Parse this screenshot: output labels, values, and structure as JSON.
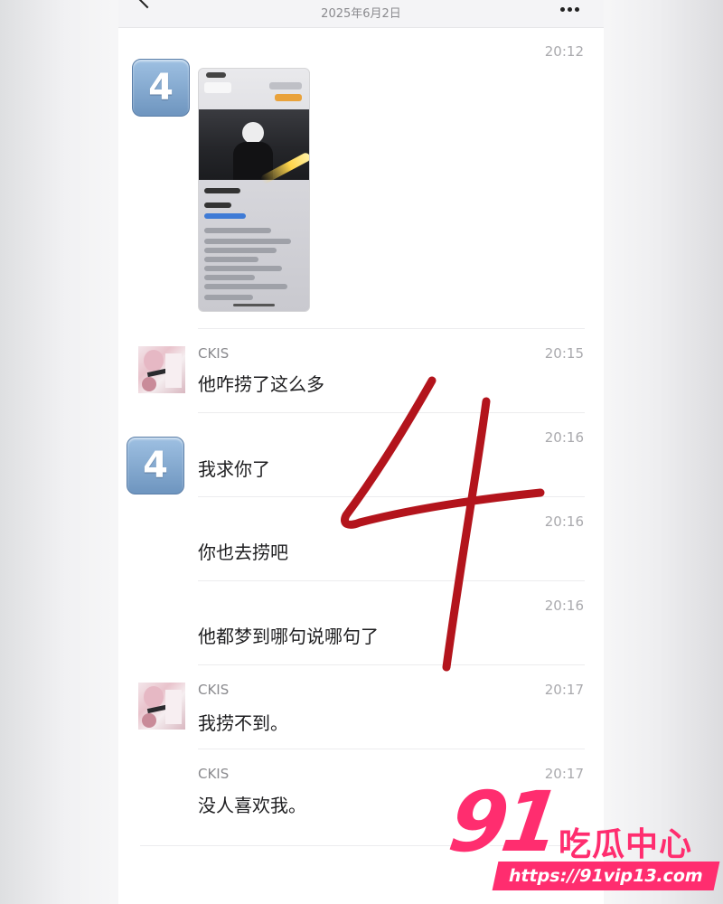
{
  "header": {
    "title": "",
    "date": "2025年6月2日"
  },
  "messages": [
    {
      "id": "m1",
      "sender": "",
      "avatar": "keycap-4-emoji",
      "time": "20:12",
      "type": "image"
    },
    {
      "id": "m2",
      "sender": "CKIS",
      "avatar": "photo",
      "time": "20:15",
      "text": "他咋捞了这么多"
    },
    {
      "id": "m3",
      "sender": "",
      "avatar": "keycap-4-emoji",
      "time": "20:16",
      "text": "我求你了"
    },
    {
      "id": "m4",
      "sender": "",
      "avatar": "",
      "time": "20:16",
      "text": "你也去捞吧"
    },
    {
      "id": "m5",
      "sender": "",
      "avatar": "",
      "time": "20:16",
      "text": "他都梦到哪句说哪句了"
    },
    {
      "id": "m6",
      "sender": "CKIS",
      "avatar": "photo",
      "time": "20:17",
      "text": "我捞不到。"
    },
    {
      "id": "m7",
      "sender": "CKIS",
      "avatar": "",
      "time": "20:17",
      "text": "没人喜欢我。"
    }
  ],
  "emoji_label": "4",
  "annotation": {
    "glyph": "4",
    "color": "#b3141c"
  },
  "watermark": {
    "number": "91",
    "name": "吃瓜中心",
    "url": "https://91vip13.com",
    "color": "#ff2d6f"
  }
}
